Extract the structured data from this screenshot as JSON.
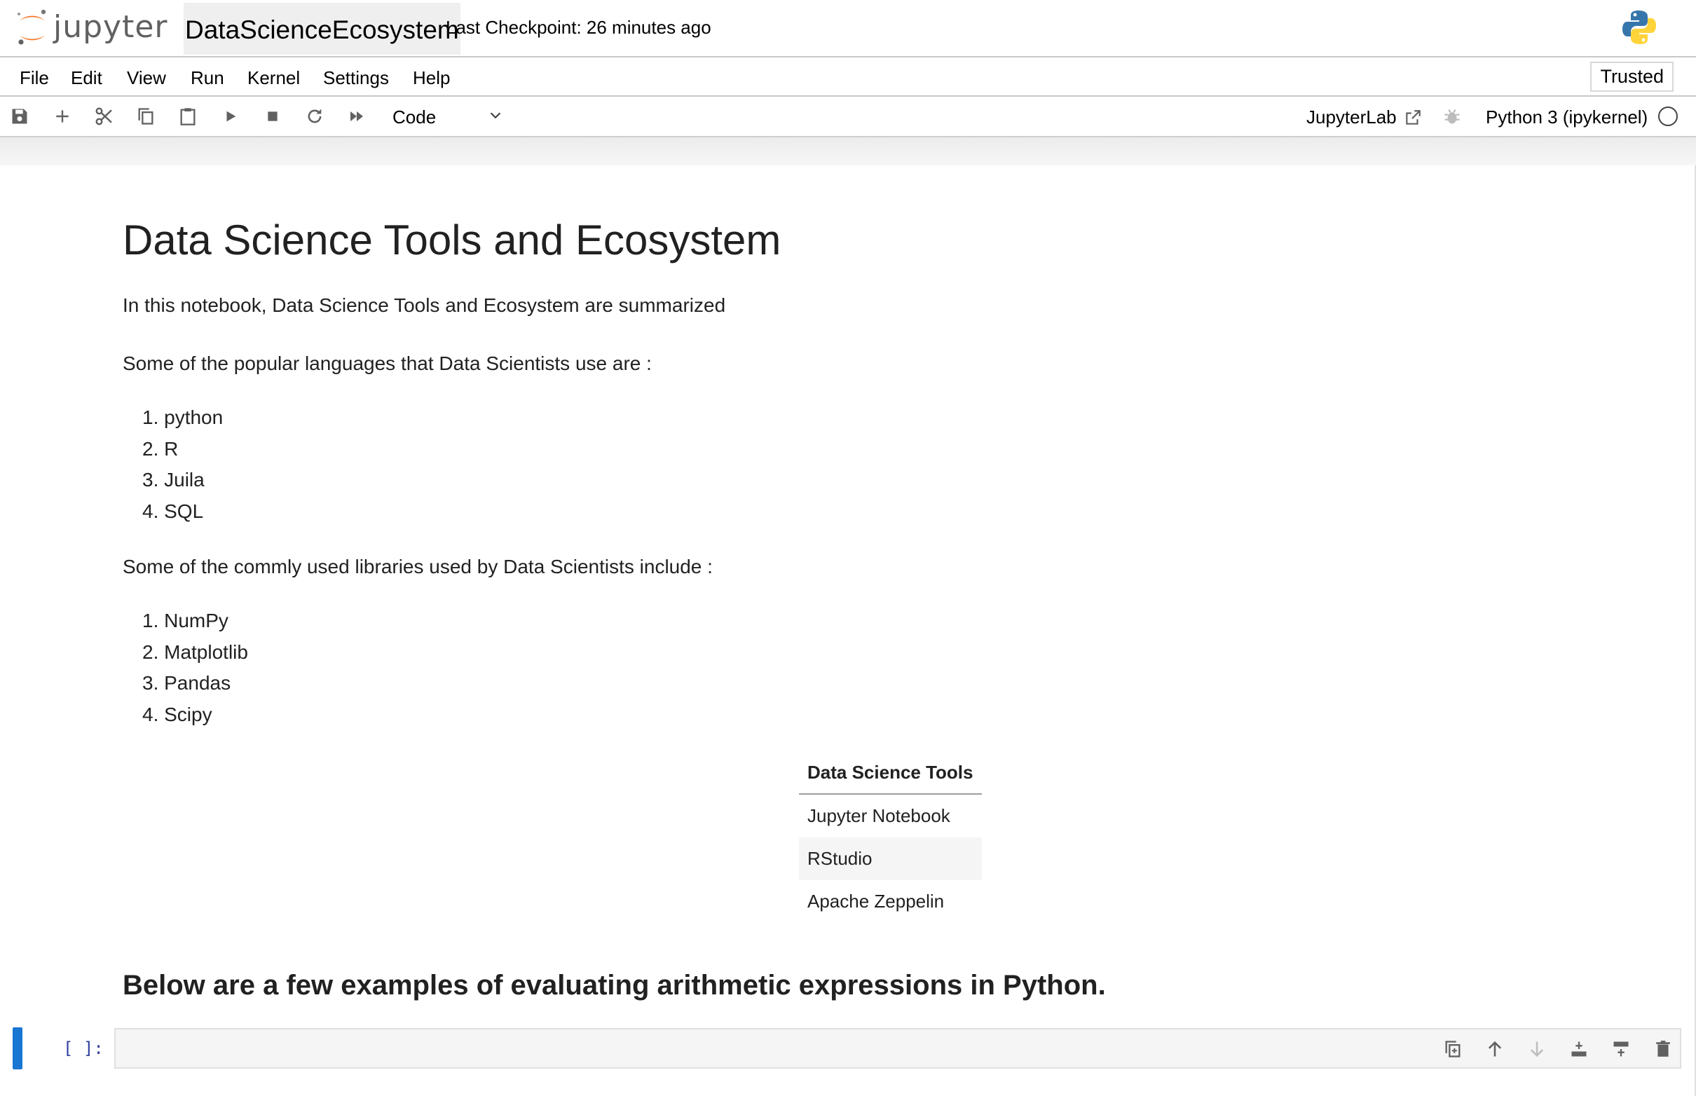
{
  "header": {
    "logo_text": "jupyter",
    "notebook_title": "DataScienceEcosystem",
    "checkpoint": "Last Checkpoint: 26 minutes ago"
  },
  "menu": {
    "items": [
      "File",
      "Edit",
      "View",
      "Run",
      "Kernel",
      "Settings",
      "Help"
    ],
    "trusted": "Trusted"
  },
  "toolbar": {
    "cell_type": "Code",
    "jupyterlab_link": "JupyterLab",
    "kernel_name": "Python 3 (ipykernel)"
  },
  "notebook": {
    "title": "Data Science Tools and Ecosystem",
    "intro": "In this notebook, Data Science Tools and Ecosystem are summarized",
    "languages_intro": "Some of the popular languages that Data Scientists use are :",
    "languages": [
      "1. python",
      "2. R",
      "3. Juila",
      "4. SQL"
    ],
    "libraries_intro": "Some of the commly used libraries used by Data Scientists include :",
    "libraries": [
      "1. NumPy",
      "2. Matplotlib",
      "3. Pandas",
      "4. Scipy"
    ],
    "tools_table": {
      "header": "Data Science Tools",
      "rows": [
        "Jupyter Notebook",
        "RStudio",
        "Apache Zeppelin"
      ]
    },
    "arithmetic_heading": "Below are a few examples of evaluating arithmetic expressions in Python.",
    "code_prompt": "[ ]:"
  },
  "colors": {
    "accent": "#1976d2",
    "jupyter_orange": "#f37726",
    "prompt": "#303f9f"
  }
}
